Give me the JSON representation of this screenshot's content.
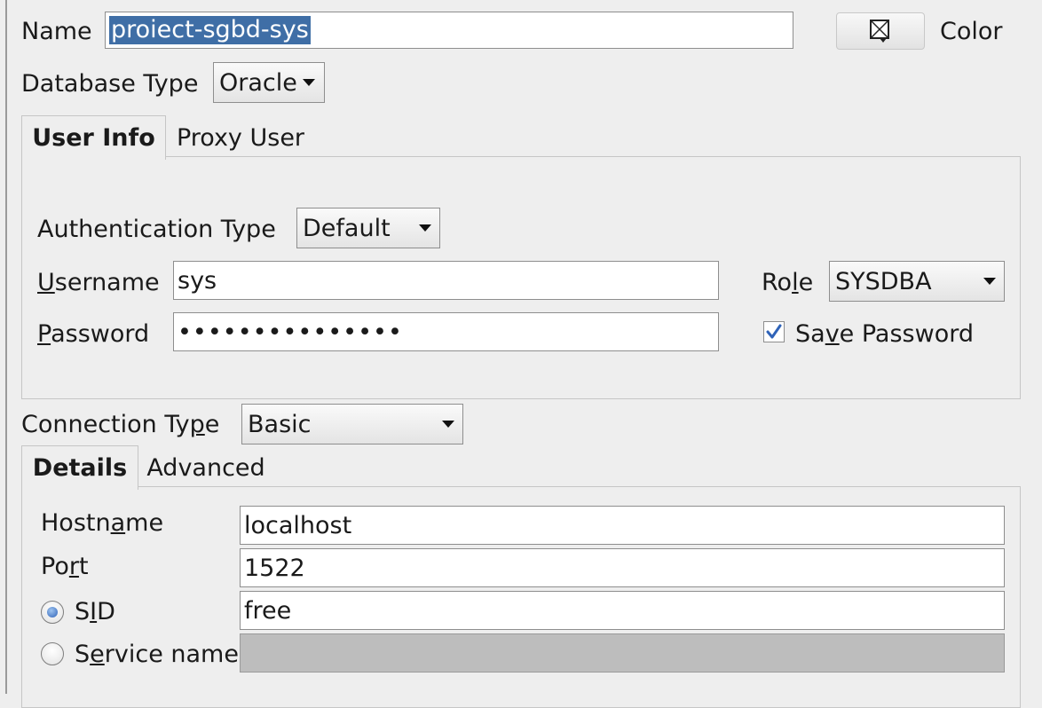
{
  "connection": {
    "name_label": "Name",
    "name_value": "proiect-sgbd-sys",
    "color_label": "Color",
    "database_type_label": "Database Type",
    "database_type_value": "Oracle"
  },
  "user_tabs": [
    {
      "label": "User Info",
      "active": true
    },
    {
      "label": "Proxy User",
      "active": false
    }
  ],
  "user_info": {
    "auth_type_label": "Authentication Type",
    "auth_type_value": "Default",
    "username_label_m": "U",
    "username_label_rest": "sername",
    "username_value": "sys",
    "password_label_m": "P",
    "password_label_rest": "assword",
    "password_value": "•••••••••••••••",
    "role_label_pre": "Ro",
    "role_label_m": "l",
    "role_label_post": "e",
    "role_value": "SYSDBA",
    "save_password_pre": "Sa",
    "save_password_m": "v",
    "save_password_post": "e Password",
    "save_password_checked": true
  },
  "connection_type": {
    "label_pre": "Connection Ty",
    "label_m": "p",
    "label_post": "e",
    "value": "Basic"
  },
  "detail_tabs": [
    {
      "label": "Details",
      "active": true
    },
    {
      "label": "Advanced",
      "active": false
    }
  ],
  "details": {
    "hostname_pre": "Hostn",
    "hostname_m": "a",
    "hostname_post": "me",
    "hostname_value": "localhost",
    "port_pre": "Po",
    "port_m": "r",
    "port_post": "t",
    "port_value": "1522",
    "sid_pre": "S",
    "sid_m": "I",
    "sid_post": "D",
    "sid_value": "free",
    "sid_selected": true,
    "service_pre": "S",
    "service_m": "e",
    "service_post": "rvice name",
    "service_value": "",
    "service_selected": false
  },
  "colors": {
    "selection": "#3f6ea6",
    "check": "#2f63b8",
    "disabled_field": "#bdbdbd"
  },
  "icons": {
    "color_button": "color-swatch-icon",
    "checkbox": "checkmark-icon",
    "radio": "radio-dot-icon"
  }
}
